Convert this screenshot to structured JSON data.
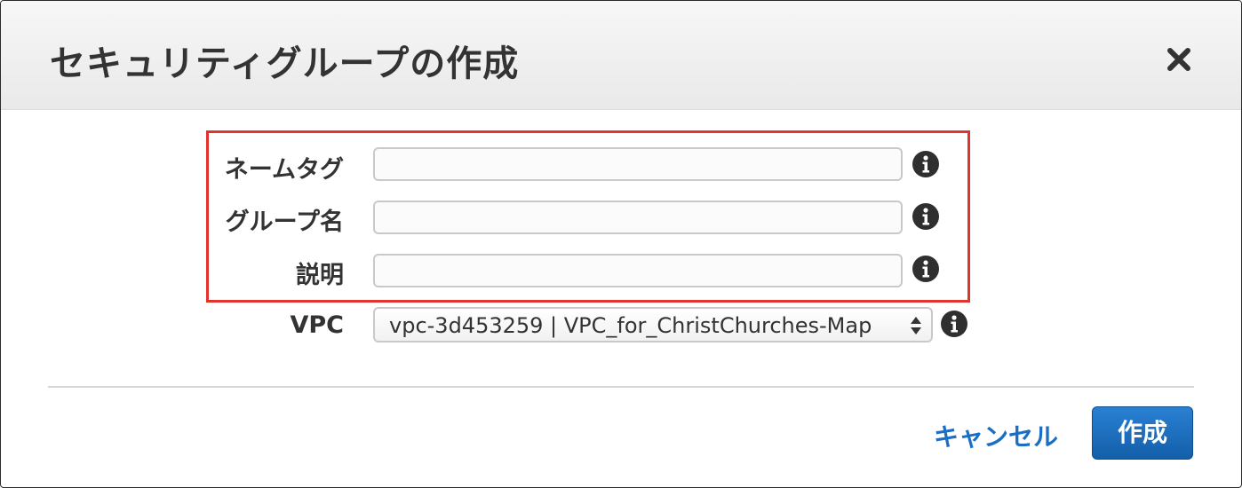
{
  "dialog": {
    "title": "セキュリティグループの作成",
    "close_icon": "close-icon"
  },
  "form": {
    "fields": [
      {
        "label": "ネームタグ",
        "value": "",
        "info_icon": "info-icon"
      },
      {
        "label": "グループ名",
        "value": "",
        "info_icon": "info-icon"
      },
      {
        "label": "説明",
        "value": "",
        "info_icon": "info-icon"
      }
    ],
    "vpc": {
      "label": "VPC",
      "selected": "vpc-3d453259 | VPC_for_ChristChurches-Map",
      "info_icon": "info-icon"
    }
  },
  "footer": {
    "cancel_label": "キャンセル",
    "create_label": "作成"
  },
  "colors": {
    "highlight": "#e0332b",
    "link": "#1a6fc4",
    "primary_button": "#1a6fc4",
    "text": "#333333"
  }
}
